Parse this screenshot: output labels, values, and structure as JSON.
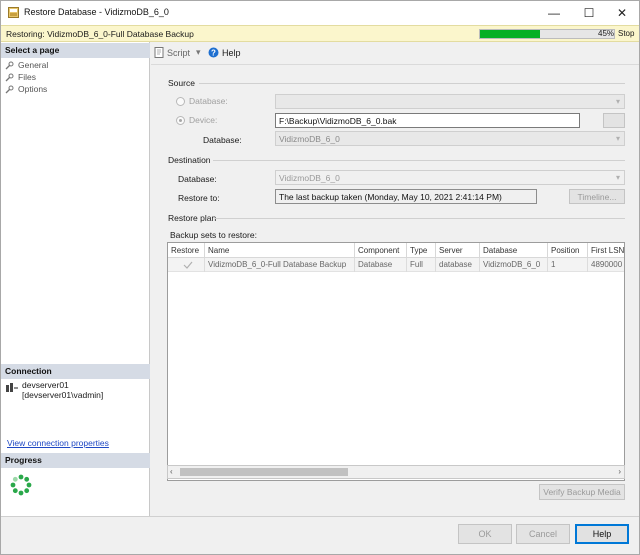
{
  "window": {
    "title": "Restore Database - VidizmoDB_6_0",
    "minimize": "—",
    "maximize": "☐",
    "close": "✕"
  },
  "status": {
    "text": "Restoring: VidizmoDB_6_0-Full Database Backup",
    "progress_percent": 45,
    "percent_label": "45%",
    "stop_label": "Stop"
  },
  "left_pane": {
    "select_page_header": "Select a page",
    "pages": [
      {
        "label": "General",
        "icon": "wrench-icon"
      },
      {
        "label": "Files",
        "icon": "wrench-icon"
      },
      {
        "label": "Options",
        "icon": "wrench-icon"
      }
    ],
    "connection_header": "Connection",
    "server": "devserver01",
    "login": "[devserver01\\vadmin]",
    "view_connection_properties": "View connection properties",
    "progress_header": "Progress"
  },
  "toolbar": {
    "script_label": "Script",
    "script_dropdown": "▾",
    "help_label": "Help"
  },
  "source": {
    "group_label": "Source",
    "database_radio_label": "Database:",
    "device_radio_label": "Device:",
    "device_path": "F:\\Backup\\VidizmoDB_6_0.bak",
    "database_label": "Database:",
    "database_value": "VidizmoDB_6_0"
  },
  "destination": {
    "group_label": "Destination",
    "database_label": "Database:",
    "database_value": "VidizmoDB_6_0",
    "restore_to_label": "Restore to:",
    "restore_to_value": "The last backup taken (Monday, May 10, 2021 2:41:14 PM)",
    "timeline_button": "Timeline..."
  },
  "restore_plan": {
    "group_label": "Restore plan",
    "backup_sets_label": "Backup sets to restore:",
    "columns": [
      "Restore",
      "Name",
      "Component",
      "Type",
      "Server",
      "Database",
      "Position",
      "First LSN"
    ],
    "rows": [
      {
        "restore_checked": true,
        "name": "VidizmoDB_6_0-Full Database Backup",
        "component": "Database",
        "type": "Full",
        "server": "database",
        "database": "VidizmoDB_6_0",
        "position": "1",
        "first_lsn": "4890000"
      }
    ],
    "verify_button": "Verify Backup Media"
  },
  "footer": {
    "ok": "OK",
    "cancel": "Cancel",
    "help": "Help"
  },
  "colors": {
    "progress_fill": "#06b025",
    "status_background": "#fbf6cc",
    "section_header": "#d5dbe5",
    "link": "#1f48c4",
    "default_button_border": "#0078d7"
  }
}
